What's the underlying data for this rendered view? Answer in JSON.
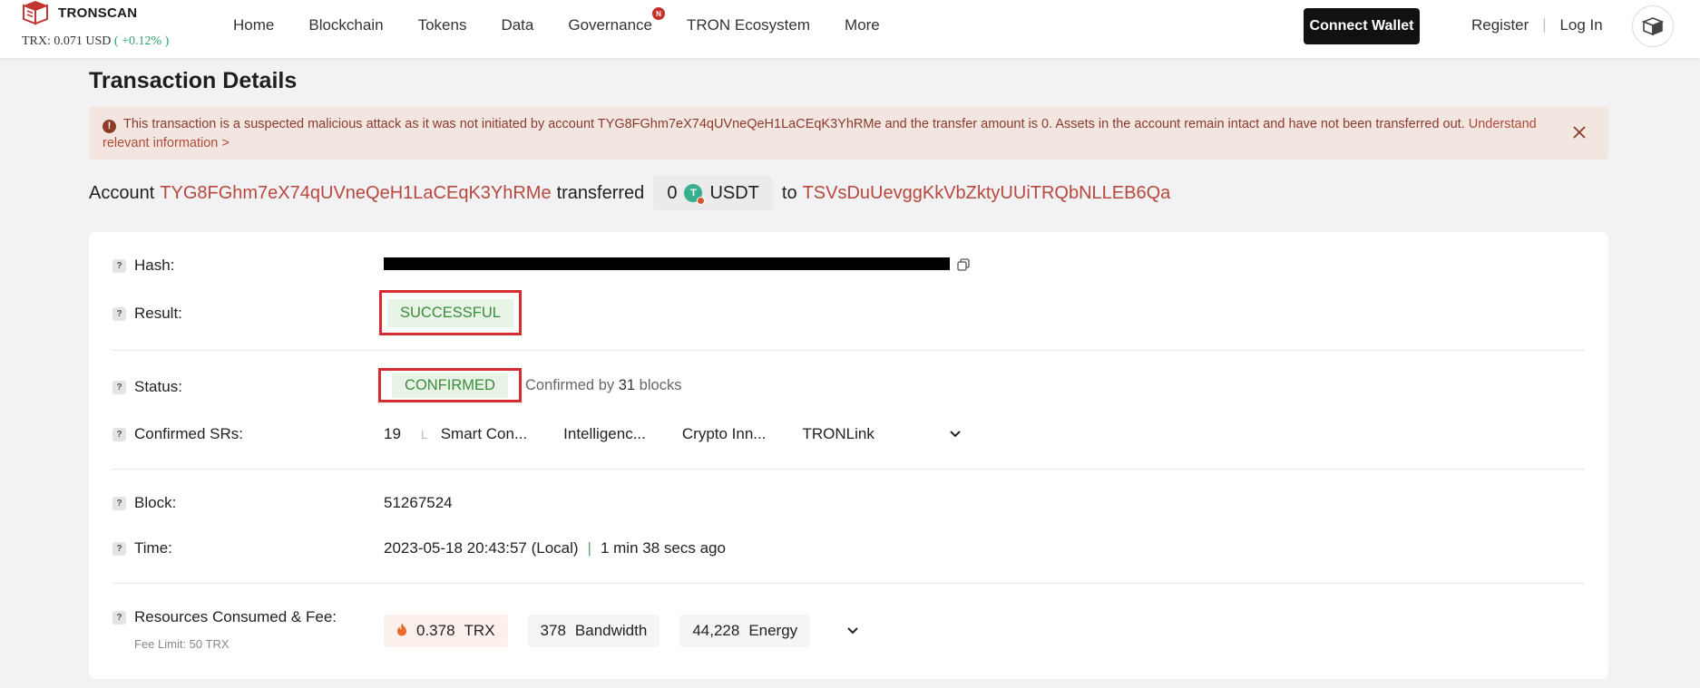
{
  "header": {
    "logo_text": "TRONSCAN",
    "price_label": "TRX:",
    "price_value": "0.071",
    "price_unit": "USD",
    "price_change": "( +0.12% )",
    "nav": [
      "Home",
      "Blockchain",
      "Tokens",
      "Data",
      "Governance",
      "TRON Ecosystem",
      "More"
    ],
    "governance_badge": "N",
    "connect_wallet": "Connect Wallet",
    "register": "Register",
    "login": "Log In"
  },
  "page": {
    "title": "Transaction Details",
    "alert": {
      "text": "This transaction is a suspected malicious attack as it was not initiated by account TYG8FGhm7eX74qUVneQeH1LaCEqK3YhRMe and the transfer amount is 0. Assets in the account remain intact and have not been transferred out.",
      "link": "Understand relevant information >"
    },
    "summary": {
      "account_label": "Account",
      "from_address": "TYG8FGhm7eX74qUVneQeH1LaCEqK3YhRMe",
      "transferred_label": "transferred",
      "amount": "0",
      "token": "USDT",
      "to_label": "to",
      "to_address": "TSVsDuUevggKkVbZktyUUiTRQbNLLEB6Qa"
    }
  },
  "details": {
    "hash_label": "Hash:",
    "result_label": "Result:",
    "result_value": "SUCCESSFUL",
    "status_label": "Status:",
    "status_value": "CONFIRMED",
    "confirmed_by_prefix": "Confirmed by",
    "confirmed_blocks": "31",
    "confirmed_by_suffix": "blocks",
    "srs_label": "Confirmed SRs:",
    "srs_count": "19",
    "srs_items": [
      "Smart Con...",
      "Intelligenc...",
      "Crypto Inn...",
      "TRONLink"
    ],
    "block_label": "Block:",
    "block_value": "51267524",
    "time_label": "Time:",
    "time_value": "2023-05-18 20:43:57 (Local)",
    "time_sep": "|",
    "time_ago": "1 min 38 secs ago",
    "resources_label": "Resources Consumed & Fee:",
    "fee_limit": "Fee Limit: 50 TRX",
    "trx_amount": "0.378",
    "trx_unit": "TRX",
    "bandwidth_amount": "378",
    "bandwidth_unit": "Bandwidth",
    "energy_amount": "44,228",
    "energy_unit": "Energy"
  },
  "colors": {
    "accent_link": "#b8483c",
    "success_green": "#3b8b3d",
    "highlight_red": "#d42c31",
    "alert_bg": "#f3e6e0"
  },
  "icons": [
    "tronscan-logo-icon",
    "governance-badge-icon",
    "account-avatar-icon",
    "alert-icon",
    "close-icon",
    "usdt-icon",
    "copy-icon",
    "help-icon",
    "chevron-down-icon",
    "flame-icon"
  ]
}
